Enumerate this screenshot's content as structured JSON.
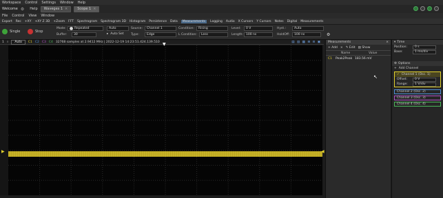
{
  "menubar": {
    "items": [
      "Workspace",
      "Control",
      "Settings",
      "Window",
      "Help"
    ]
  },
  "tabbar": {
    "welcome": "Welcome",
    "help": "Help",
    "tabs": [
      {
        "label": "Waveges 1",
        "close": "×"
      },
      {
        "label": "Scope 1",
        "close": "×"
      }
    ]
  },
  "submenu": {
    "items": [
      "File",
      "Control",
      "View",
      "Window"
    ]
  },
  "toolbar": {
    "items": [
      "Export",
      "Rec",
      "+XY",
      "+XY Z 3D",
      "+Zoom",
      "FFT",
      "Spectrogram",
      "Spectrogram 3D",
      "Histogram",
      "Persistence",
      "Data",
      "Measurements",
      "Logging",
      "Audio",
      "X Cursors",
      "Y Cursors",
      "Notes",
      "Digital",
      "Measurements"
    ]
  },
  "controls": {
    "single": "Single",
    "stop": "Stop",
    "mode_label": "Mode:",
    "mode_value": "Repeated",
    "buffer_label": "Buffer:",
    "buffer_value": "30",
    "auto_label": "Auto",
    "autoset_label": "Auto Set",
    "source_label": "Source:",
    "source_value": "Channel 1",
    "type_label": "Type:",
    "type_value": "Edge",
    "condition_label": "Condition:",
    "condition_value": "Rising",
    "lcondition_label": "L Condition:",
    "lcondition_value": "Less",
    "level_label": "Level:",
    "level_value": "0 V",
    "length_label": "Length:",
    "length_value": "100 ns",
    "hyst_label": "Hyst.:",
    "hyst_value": "Auto",
    "holdoff_label": "HoldOff:",
    "holdoff_value": "100 ns"
  },
  "scope_header": {
    "index": "1",
    "mode": "Auto",
    "channels": [
      "C1",
      "C2",
      "C3",
      "C4"
    ],
    "info": "32768 samples at 2.9412 MHz | 2022-12-19 14:23:51.424.139.510"
  },
  "colors": {
    "trace": "#d9c32a",
    "ch1": "#e3d22c",
    "ch2": "#4f8fd8",
    "ch3": "#b250c8",
    "ch4": "#4bb85a"
  },
  "measurements": {
    "title": "Measurements",
    "add": "Add",
    "edit": "Edit",
    "show": "Show",
    "col_name": "Name",
    "col_value": "Value",
    "rows": [
      {
        "name": "Peak2Peak",
        "value": "183.56 mV"
      }
    ]
  },
  "right_panel": {
    "time_title": "Time",
    "position_label": "Position:",
    "position_value": "0 s",
    "base_label": "Base:",
    "base_value": "1 ms/div",
    "options_title": "Options",
    "add_channel": "Add Channel",
    "channel1": {
      "label": "Channel 1 (Osc. 1)",
      "offset_label": "Offset:",
      "offset_value": "0 V",
      "range_label": "Range:",
      "range_value": "1 V/div"
    },
    "channels": [
      "Channel 2 (Osc. 2)",
      "Channel 3 (Osc. 3)",
      "Channel 4 (Osc. 4)"
    ]
  }
}
